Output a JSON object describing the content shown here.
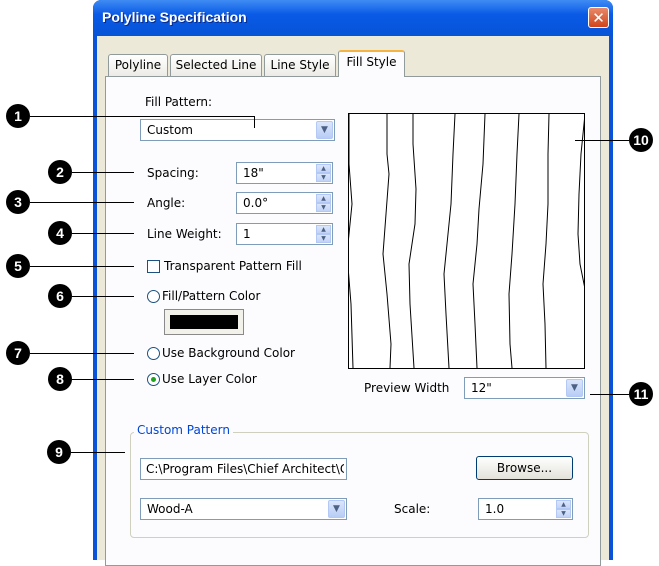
{
  "window": {
    "title": "Polyline Specification",
    "close_glyph": "✕"
  },
  "tabs": [
    {
      "label": "Polyline",
      "active": false
    },
    {
      "label": "Selected Line",
      "active": false
    },
    {
      "label": "Line Style",
      "active": false
    },
    {
      "label": "Fill Style",
      "active": true
    }
  ],
  "fill_pattern": {
    "label": "Fill Pattern:",
    "value": "Custom"
  },
  "spacing": {
    "label": "Spacing:",
    "value": "18\""
  },
  "angle": {
    "label": "Angle:",
    "value": "0.0°"
  },
  "line_weight": {
    "label": "Line Weight:",
    "value": "1"
  },
  "transparent": {
    "label": "Transparent Pattern Fill",
    "checked": false
  },
  "fill_color": {
    "label": "Fill/Pattern Color",
    "selected": false,
    "color": "#000000"
  },
  "background_color": {
    "label": "Use Background Color",
    "selected": false
  },
  "layer_color": {
    "label": "Use Layer Color",
    "selected": true
  },
  "preview_width": {
    "label": "Preview Width",
    "value": "12\""
  },
  "custom_pattern": {
    "title": "Custom Pattern",
    "path": "C:\\Program Files\\Chief Architect\\Chief Archite",
    "browse_label": "Browse...",
    "pattern_name": "Wood-A",
    "scale_label": "Scale:",
    "scale_value": "1.0"
  },
  "callouts": [
    "1",
    "2",
    "3",
    "4",
    "5",
    "6",
    "7",
    "8",
    "9",
    "10",
    "11"
  ],
  "colors": {
    "title_blue": "#0a52d8",
    "dialog_bg": "#ece9d8",
    "accent_tab": "#f4b443",
    "group_title": "#0046d5"
  }
}
